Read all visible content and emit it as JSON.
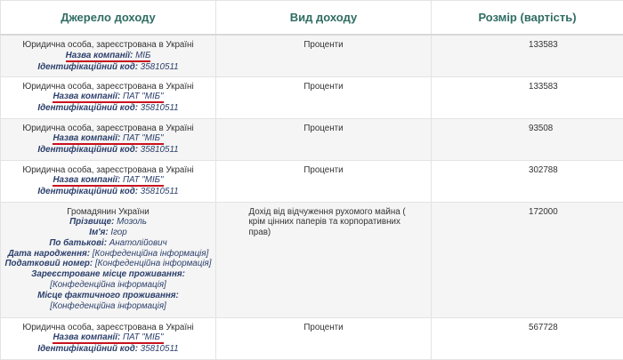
{
  "header": {
    "col_source": "Джерело доходу",
    "col_type": "Вид доходу",
    "col_amount": "Розмір (вартість)"
  },
  "labels": {
    "company_name": "Назва компанії:",
    "id_code": "Ідентифікаційний код:",
    "surname": "Прізвище:",
    "first_name": "Ім'я:",
    "patronymic": "По батькові:",
    "birth_date": "Дата народження:",
    "tax_number": "Податковий номер:",
    "reg_place": "Зареєстроване місце проживання:",
    "actual_place": "Місце фактичного проживання:"
  },
  "rows": [
    {
      "entity": "Юридична особа, зареєстрована в Україні",
      "company": "МІБ",
      "code": "35810511",
      "type": "Проценти",
      "amount": "133583"
    },
    {
      "entity": "Юридична особа, зареєстрована в Україні",
      "company": "ПАТ \"МІБ\"",
      "code": "35810511",
      "type": "Проценти",
      "amount": "133583"
    },
    {
      "entity": "Юридична особа, зареєстрована в Україні",
      "company": "ПАТ \"МІБ\"",
      "code": "35810511",
      "type": "Проценти",
      "amount": "93508"
    },
    {
      "entity": "Юридична особа, зареєстрована в Україні",
      "company": "ПАТ \"МІБ\"",
      "code": "35810511",
      "type": "Проценти",
      "amount": "302788"
    },
    {
      "entity": "Громадянин України",
      "surname": "Мозоль",
      "first_name": "Ігор",
      "patronymic": "Анатолійович",
      "confidential": "[Конфеденційна інформація]",
      "type": "Дохід від відчуження рухомого майна ( крім цінних паперів та корпоративних прав)",
      "amount": "172000"
    },
    {
      "entity": "Юридична особа, зареєстрована в Україні",
      "company": "ПАТ \"МІБ\"",
      "code": "35810511",
      "type": "Проценти",
      "amount": "567728"
    }
  ]
}
